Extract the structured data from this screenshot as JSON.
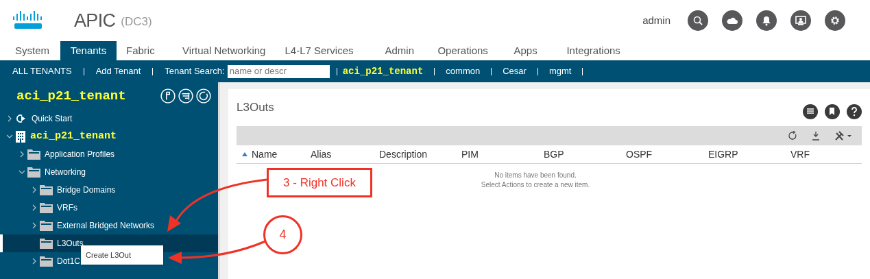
{
  "header": {
    "product": "APIC",
    "site": "(DC3)",
    "user": "admin"
  },
  "tabs": [
    {
      "label": "System",
      "selected": false
    },
    {
      "label": "Tenants",
      "selected": true
    },
    {
      "label": "Fabric",
      "selected": false
    },
    {
      "label": "Virtual Networking",
      "selected": false
    },
    {
      "label": "L4-L7 Services",
      "selected": false
    },
    {
      "label": "Admin",
      "selected": false
    },
    {
      "label": "Operations",
      "selected": false
    },
    {
      "label": "Apps",
      "selected": false
    },
    {
      "label": "Integrations",
      "selected": false
    }
  ],
  "tenant_bar": {
    "items": [
      {
        "label": "ALL TENANTS",
        "current": false
      },
      {
        "label": "Add Tenant",
        "current": false
      }
    ],
    "search_label": "Tenant Search:",
    "search_placeholder": "name or descr",
    "tenants": [
      {
        "label": "aci_p21_tenant",
        "current": true
      },
      {
        "label": "common",
        "current": false
      },
      {
        "label": "Cesar",
        "current": false
      },
      {
        "label": "mgmt",
        "current": false
      }
    ]
  },
  "sidebar": {
    "title": "aci_p21_tenant",
    "tree": [
      {
        "label": "Quick Start",
        "kind": "quickstart",
        "expanded": false,
        "selected": false
      },
      {
        "label": "aci_p21_tenant",
        "kind": "tenant",
        "expanded": true,
        "selected": false,
        "children": [
          {
            "label": "Application Profiles",
            "kind": "folder",
            "expanded": false,
            "selected": false
          },
          {
            "label": "Networking",
            "kind": "folder",
            "expanded": true,
            "selected": false,
            "children": [
              {
                "label": "Bridge Domains",
                "kind": "folder",
                "expanded": false,
                "selected": false
              },
              {
                "label": "VRFs",
                "kind": "folder",
                "expanded": false,
                "selected": false
              },
              {
                "label": "External Bridged Networks",
                "kind": "folder",
                "expanded": false,
                "selected": false
              },
              {
                "label": "L3Outs",
                "kind": "folder",
                "selected": true
              },
              {
                "label": "Dot1C",
                "kind": "folder",
                "expanded": false,
                "selected": false
              }
            ]
          }
        ]
      }
    ]
  },
  "context_menu": {
    "items": [
      "Create L3Out"
    ]
  },
  "panel": {
    "title": "L3Outs",
    "table": {
      "columns": [
        {
          "label": "Name",
          "sorted": true
        },
        {
          "label": "Alias",
          "sorted": false
        },
        {
          "label": "Description",
          "sorted": false
        },
        {
          "label": "PIM",
          "sorted": false
        },
        {
          "label": "BGP",
          "sorted": false
        },
        {
          "label": "OSPF",
          "sorted": false
        },
        {
          "label": "EIGRP",
          "sorted": false
        },
        {
          "label": "VRF",
          "sorted": false
        }
      ],
      "empty_message": [
        "No items have been found.",
        "Select Actions to create a new item."
      ]
    }
  },
  "annotations": [
    {
      "kind": "box",
      "text": "3 - Right Click"
    },
    {
      "kind": "circle",
      "text": "4"
    }
  ]
}
